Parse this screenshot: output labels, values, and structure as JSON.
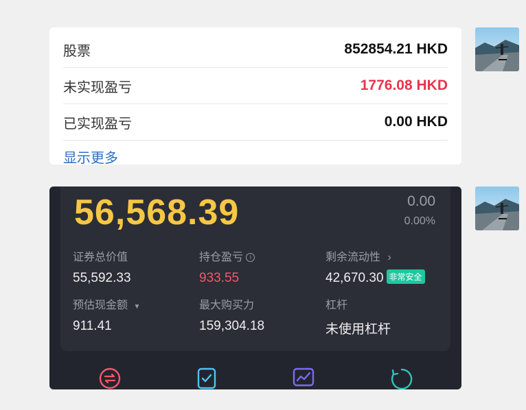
{
  "assets_card": {
    "rows": [
      {
        "label": "股票",
        "value": "852854.21 HKD",
        "color": "#111111"
      },
      {
        "label": "未实现盈亏",
        "value": "1776.08 HKD",
        "color": "#e8344e"
      },
      {
        "label": "已实现盈亏",
        "value": "0.00 HKD",
        "color": "#111111"
      }
    ],
    "show_more": "显示更多"
  },
  "account_card": {
    "total_value": "56,568.39",
    "day_change": "0.00",
    "day_change_pct": "0.00%",
    "metrics": {
      "securities_value": {
        "label": "证券总价值",
        "value": "55,592.33"
      },
      "position_pnl": {
        "label": "持仓盈亏",
        "value": "933.55"
      },
      "remaining_liquidity": {
        "label": "剩余流动性",
        "value": "42,670.30",
        "badge": "非常安全"
      },
      "estimated_cash": {
        "label": "预估现金额",
        "value": "911.41"
      },
      "max_buying_power": {
        "label": "最大购买力",
        "value": "159,304.18"
      },
      "leverage": {
        "label": "杠杆",
        "value": "未使用杠杆"
      }
    },
    "icons": [
      "transfer-icon",
      "order-check-icon",
      "chart-icon",
      "refresh-icon"
    ]
  },
  "colors": {
    "gold": "#f6c744",
    "loss_red": "#e8344e",
    "safe_green": "#1fc7a0",
    "link_blue": "#2f6fbf"
  }
}
